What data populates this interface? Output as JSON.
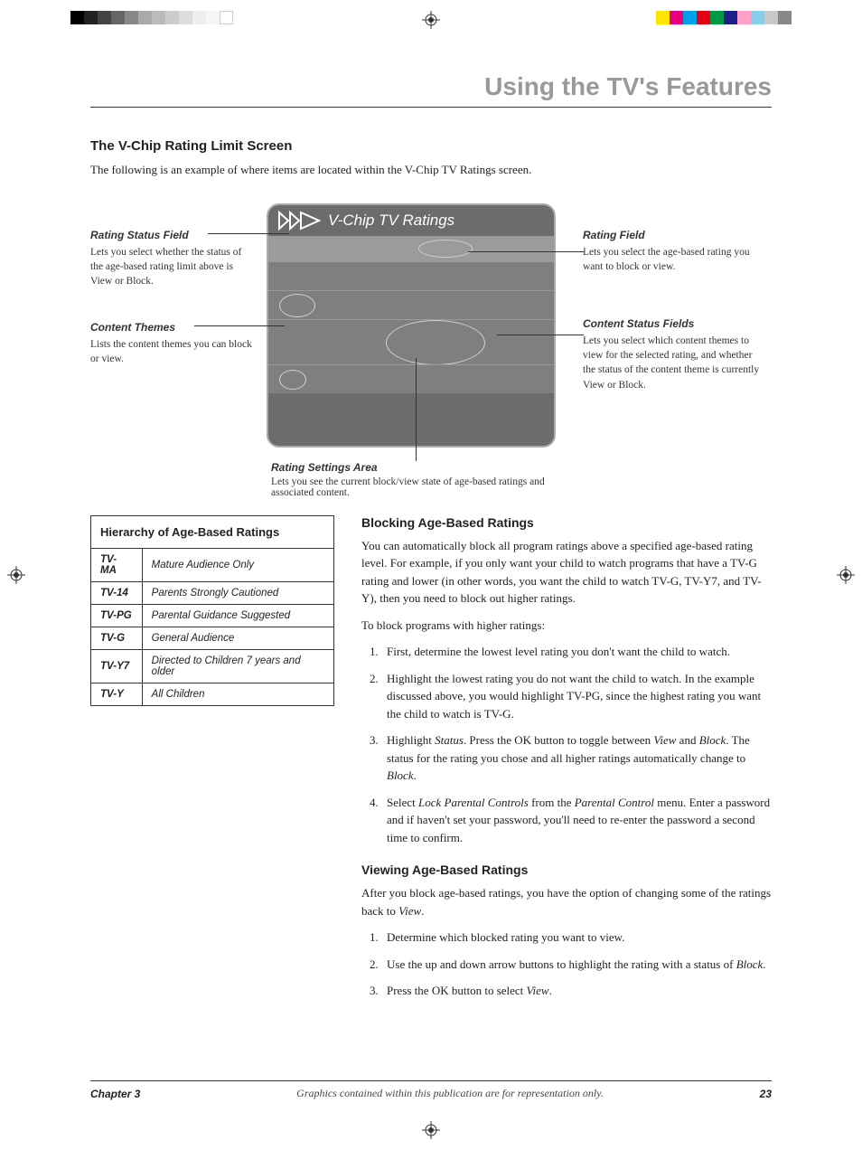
{
  "page": {
    "chapter_title": "Using the TV's Features",
    "section_title": "The V-Chip Rating Limit Screen",
    "section_intro": "The following is an example of where items are located within the V-Chip TV Ratings screen.",
    "tv_screen_title": "V-Chip TV Ratings"
  },
  "callouts": {
    "rating_status": {
      "title": "Rating Status Field",
      "body": "Lets you select whether the status of the age-based rating limit above is View or Block."
    },
    "content_themes": {
      "title": "Content Themes",
      "body": "Lists the content themes you can block or view."
    },
    "rating_field": {
      "title": "Rating Field",
      "body": "Lets you select the age-based rating you want to block or view."
    },
    "content_status": {
      "title": "Content Status Fields",
      "body": "Lets you select which content themes to view for the selected rating, and whether the status of the content theme is currently View or Block."
    },
    "rating_settings": {
      "title": "Rating Settings Area",
      "body": "Lets you see the current block/view state of age-based ratings and associated content."
    }
  },
  "ratings_table": {
    "header": "Hierarchy of Age-Based Ratings",
    "rows": [
      {
        "code": "TV-MA",
        "desc": "Mature Audience Only"
      },
      {
        "code": "TV-14",
        "desc": "Parents Strongly Cautioned"
      },
      {
        "code": "TV-PG",
        "desc": "Parental Guidance Suggested"
      },
      {
        "code": "TV-G",
        "desc": "General Audience"
      },
      {
        "code": "TV-Y7",
        "desc": "Directed to Children 7 years and older"
      },
      {
        "code": "TV-Y",
        "desc": "All Children"
      }
    ]
  },
  "blocking": {
    "heading": "Blocking Age-Based Ratings",
    "intro": "You can automatically block all program ratings above a specified age-based rating level. For example, if you only want your child to watch programs that have a TV-G rating and lower (in other words, you want the child to watch TV-G, TV-Y7, and TV-Y), then you need to block out higher ratings.",
    "lead": "To block programs with higher ratings:",
    "steps": {
      "s1": "First, determine the lowest level rating you don't want the child to watch.",
      "s2": "Highlight the lowest rating you do not want the child to watch. In the example discussed above, you would highlight TV-PG, since the highest rating you want the child to watch is TV-G.",
      "s3_pre": "Highlight ",
      "s3_em1": "Status",
      "s3_mid1": ". Press the OK button to toggle between ",
      "s3_em2": "View",
      "s3_mid2": " and ",
      "s3_em3": "Block",
      "s3_mid3": ". The status for the rating you chose and all higher ratings automatically change to ",
      "s3_em4": "Block",
      "s3_end": ".",
      "s4_pre": "Select ",
      "s4_em1": "Lock Parental Controls",
      "s4_mid1": " from the ",
      "s4_em2": "Parental Control",
      "s4_end": " menu. Enter a password and if haven't set your password, you'll need to re-enter the password a second time to confirm."
    }
  },
  "viewing": {
    "heading": "Viewing Age-Based Ratings",
    "intro_pre": "After you block age-based ratings, you have the option of changing some of the ratings back to ",
    "intro_em": "View",
    "intro_end": ".",
    "steps": {
      "s1": "Determine which blocked rating you want to view.",
      "s2_pre": "Use the up and down arrow buttons to highlight the rating with a status of ",
      "s2_em": "Block",
      "s2_end": ".",
      "s3_pre": "Press the OK button to select ",
      "s3_em": "View",
      "s3_end": "."
    }
  },
  "footer": {
    "chapter": "Chapter 3",
    "note": "Graphics contained within this publication are for representation only.",
    "page": "23"
  },
  "print_marks": {
    "left_swatches": [
      "#000",
      "#222",
      "#444",
      "#666",
      "#888",
      "#aaa",
      "#bbb",
      "#ccc",
      "#ddd",
      "#eee",
      "#f6f6f6",
      "#fff"
    ],
    "right_swatches": [
      "#ffe400",
      "#e4007f",
      "#00a0e9",
      "#e60012",
      "#009944",
      "#1d2088",
      "#ffa0c9",
      "#87ceeb",
      "#c8c8c8",
      "#888"
    ]
  }
}
